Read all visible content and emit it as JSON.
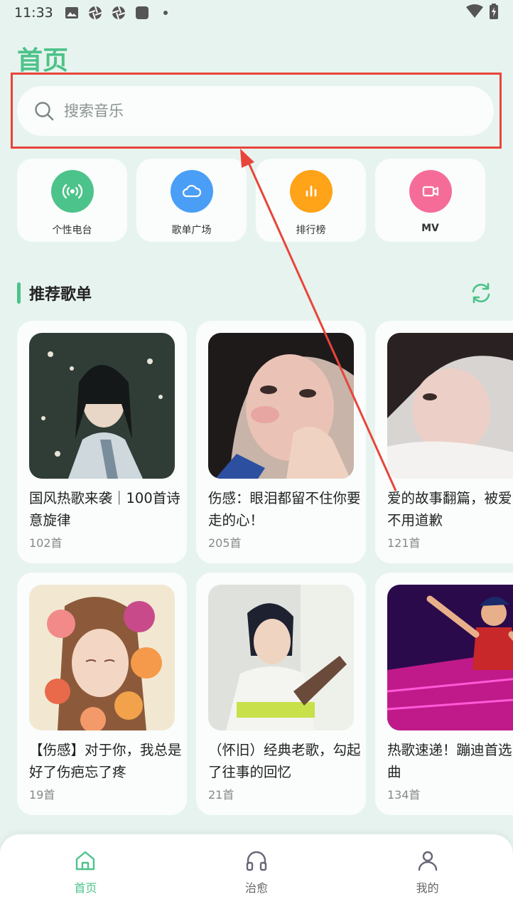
{
  "status_bar": {
    "time": "11:33"
  },
  "header": {
    "title": "首页"
  },
  "search": {
    "placeholder": "搜索音乐",
    "value": ""
  },
  "quick_entries": [
    {
      "label": "个性电台",
      "icon": "radio-icon",
      "color": "#4cc38a"
    },
    {
      "label": "歌单广场",
      "icon": "cloud-icon",
      "color": "#4a9ef6"
    },
    {
      "label": "排行榜",
      "icon": "bar-chart-icon",
      "color": "#ffa318"
    },
    {
      "label": "MV",
      "icon": "video-camera-icon",
      "color": "#f66c98"
    }
  ],
  "recommend": {
    "title": "推荐歌单",
    "playlists": [
      {
        "name": "国风热歌来袭｜100首诗意旋律",
        "count": "102首"
      },
      {
        "name": "伤感：眼泪都留不住你要走的心！",
        "count": "205首"
      },
      {
        "name": "爱的故事翻篇，被爱的人不用道歉",
        "count": "121首"
      },
      {
        "name": "【伤感】对于你，我总是好了伤疤忘了疼",
        "count": "19首"
      },
      {
        "name": "（怀旧）经典老歌，勾起了往事的回忆",
        "count": "21首"
      },
      {
        "name": "热歌速递！蹦迪首选DJ舞曲",
        "count": "134首"
      }
    ]
  },
  "bottom_nav": {
    "items": [
      {
        "label": "首页",
        "icon": "home-icon",
        "active": true
      },
      {
        "label": "治愈",
        "icon": "headphones-icon",
        "active": false
      },
      {
        "label": "我的",
        "icon": "user-icon",
        "active": false
      }
    ]
  },
  "colors": {
    "accent": "#4cc38a",
    "annotation": "#e8453c",
    "background": "#e7f3ee"
  }
}
